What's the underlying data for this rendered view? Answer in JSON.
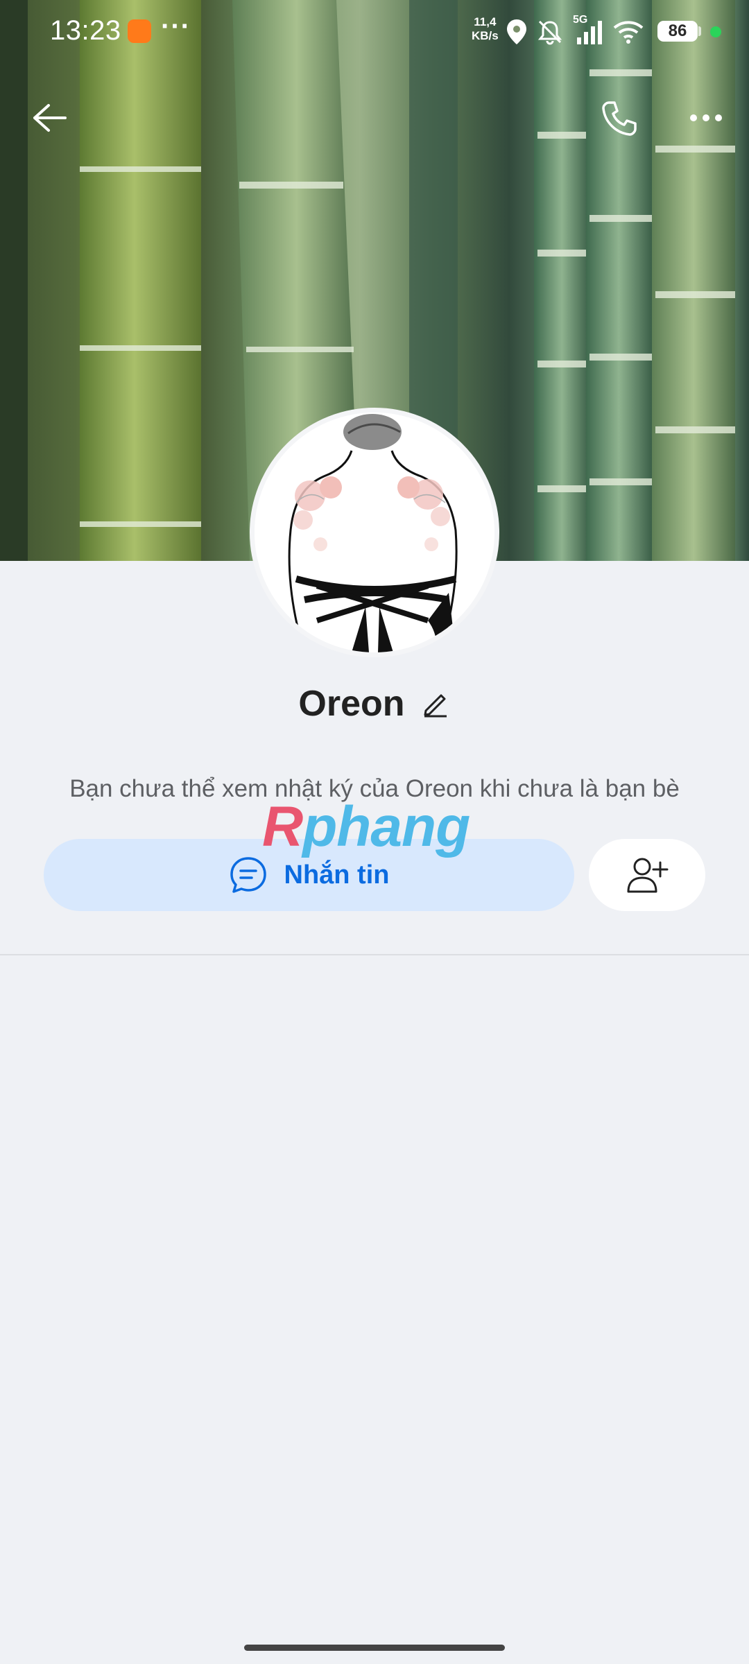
{
  "status_bar": {
    "time": "13:23",
    "dots": "···",
    "net_speed_value": "11,4",
    "net_speed_unit": "KB/s",
    "network_type": "5G",
    "battery": "86"
  },
  "header": {
    "back_icon": "arrow-left-icon",
    "call_icon": "phone-icon",
    "more_icon": "more-horizontal-icon"
  },
  "profile": {
    "name": "Oreon",
    "info_text": "Bạn chưa thể xem nhật ký của Oreon khi chưa là bạn bè"
  },
  "watermark": {
    "part1": "R",
    "part2": "phang"
  },
  "actions": {
    "message_label": "Nhắn tin",
    "message_icon": "chat-bubble-icon",
    "add_friend_icon": "add-user-icon"
  },
  "colors": {
    "accent": "#0b6be0",
    "button_bg": "#d8e8fd",
    "page_bg": "#eff1f5"
  }
}
